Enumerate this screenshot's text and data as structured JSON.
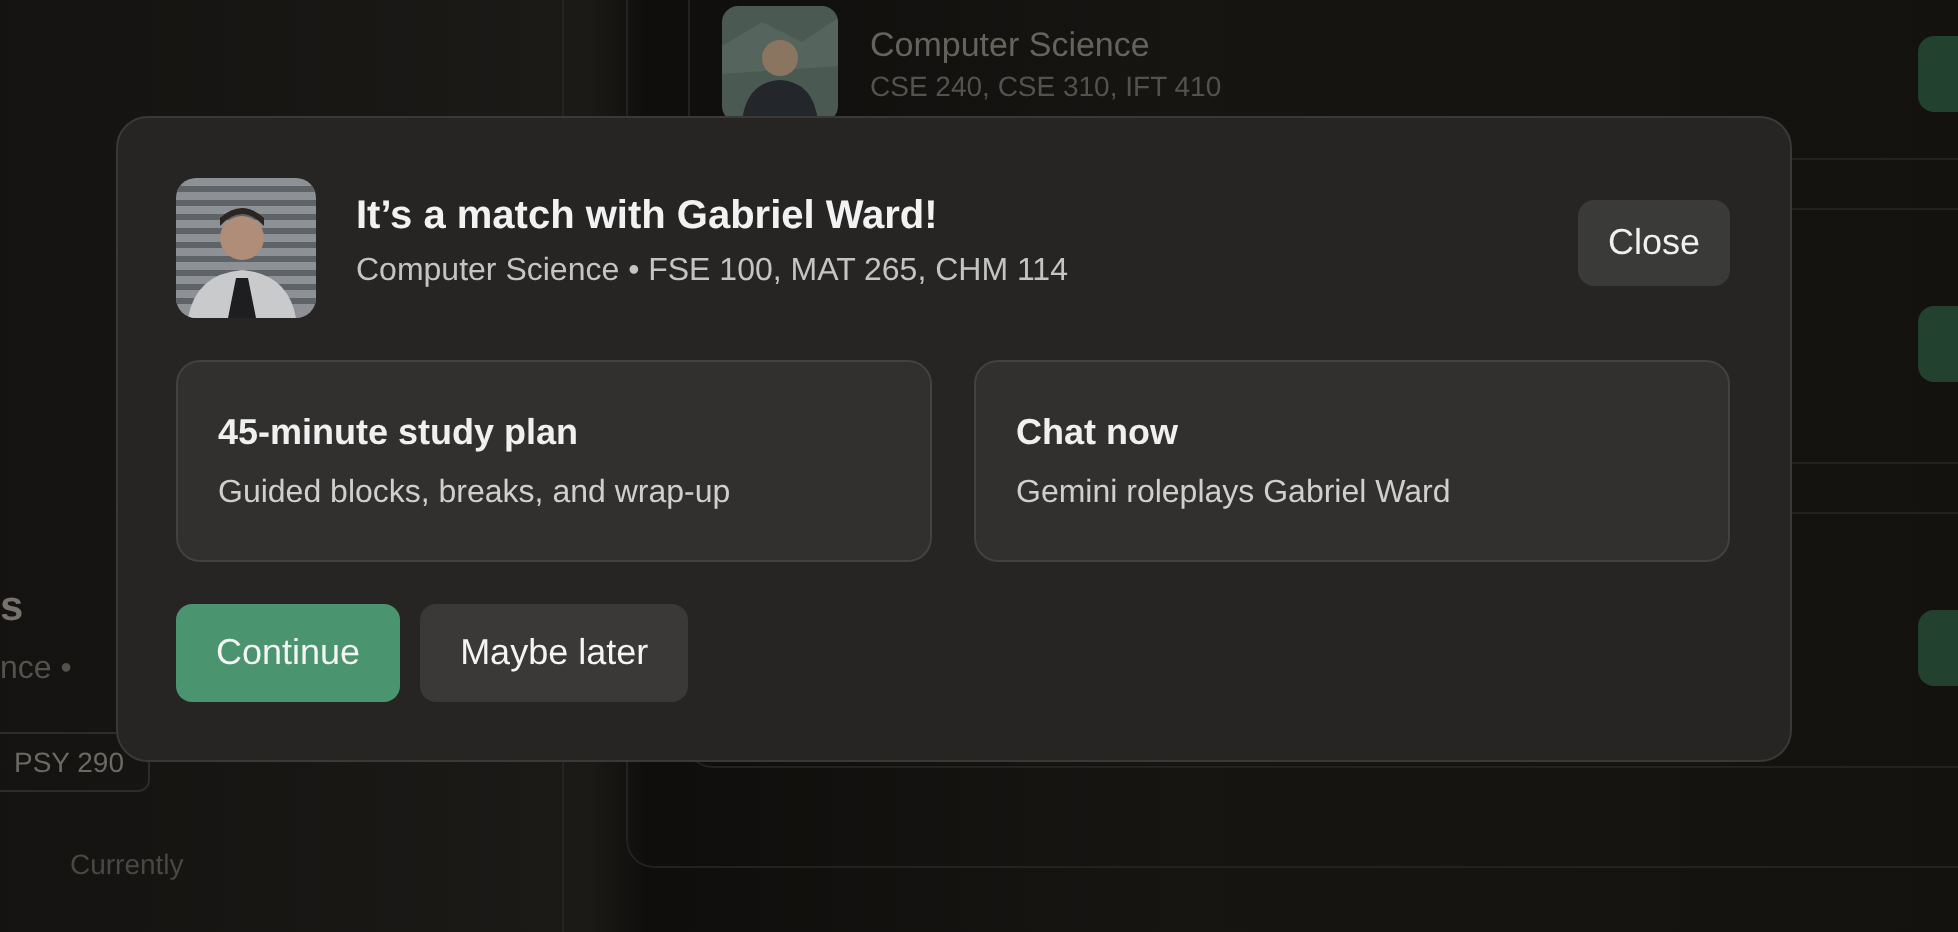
{
  "profile": {
    "title": "s",
    "subtitle": "nce •",
    "courses": [
      "PSY 290"
    ],
    "section_label": "Currently"
  },
  "matches": [
    {
      "major": "Computer Science",
      "courses": "CSE 240, CSE 310, IFT 410"
    }
  ],
  "modal": {
    "title": "It’s a match with Gabriel Ward!",
    "subtitle": "Computer Science • FSE 100, MAT 265, CHM 114",
    "close": "Close",
    "options": [
      {
        "title": "45-minute study plan",
        "description": "Guided blocks, breaks, and wrap-up"
      },
      {
        "title": "Chat now",
        "description": "Gemini roleplays Gabriel Ward"
      }
    ],
    "buttons": [
      {
        "label": "Continue",
        "kind": "primary"
      },
      {
        "label": "Maybe later",
        "kind": "secondary"
      }
    ]
  }
}
